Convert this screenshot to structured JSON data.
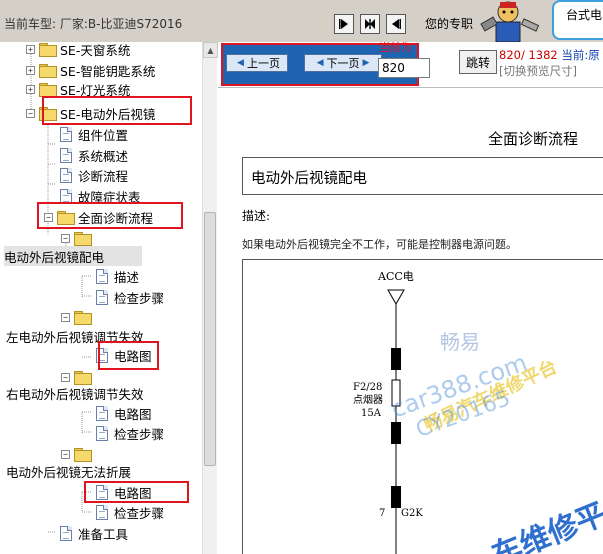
{
  "header": {
    "model_label": "当前车型:  厂家:B-比亚迪S72016",
    "welcome": "您的专职",
    "desk_label": "台式电"
  },
  "nav_buttons": [
    {
      "icon": "arrow-right-icon"
    },
    {
      "icon": "double-arrow-icon"
    },
    {
      "icon": "arrow-left-icon"
    }
  ],
  "tree": {
    "items": [
      {
        "label": "SE-天窗系统"
      },
      {
        "label": "SE-智能钥匙系统"
      },
      {
        "label": "SE-灯光系统"
      },
      {
        "label": "SE-电动外后视镜"
      },
      {
        "label": "组件位置"
      },
      {
        "label": "系统概述"
      },
      {
        "label": "诊断流程"
      },
      {
        "label": "故障症状表"
      },
      {
        "label": "全面诊断流程"
      },
      {
        "label": "电动外后视镜配电"
      },
      {
        "label": "描述"
      },
      {
        "label": "检查步骤"
      },
      {
        "label": "左电动外后视镜调节失效"
      },
      {
        "label": "电路图"
      },
      {
        "label": "右电动外后视镜调节失效"
      },
      {
        "label": "电路图"
      },
      {
        "label": "检查步骤"
      },
      {
        "label": "电动外后视镜无法折展"
      },
      {
        "label": "电路图"
      },
      {
        "label": "检查步骤"
      },
      {
        "label": "准备工具"
      }
    ]
  },
  "toolbar": {
    "prev_label": "上一页",
    "next_label": "下一页",
    "current_label": "当前为",
    "page_value": "820",
    "jump_label": "跳转",
    "page_info": "820/ 1382",
    "page_info_current": "当前:原",
    "switch_size": "[切换预览尺寸]"
  },
  "document": {
    "title": "全面诊断流程",
    "section_title": "电动外后视镜配电",
    "desc_label": "描述:",
    "desc_text": "如果电动外后视镜完全不工作，可能是控制器电源问题。",
    "diagram": {
      "source_label": "ACC电",
      "fuse_label_1": "F2/28",
      "fuse_label_2": "点烟器",
      "fuse_label_3": "15A",
      "connector_label_1": "7",
      "connector_label_2": "G2K"
    }
  },
  "watermarks": {
    "brand": "畅易",
    "site": "car388.com",
    "platform": "畅易汽车维修平台",
    "code": "CY20165",
    "platform_short": "车维修平"
  },
  "colors": {
    "highlight_red": "#e0141e",
    "pager_blue": "#1f64b0",
    "folder_yellow": "#f6d96b",
    "watermark_blue": "#4a8fd8",
    "watermark_yellow": "#e8c830"
  }
}
